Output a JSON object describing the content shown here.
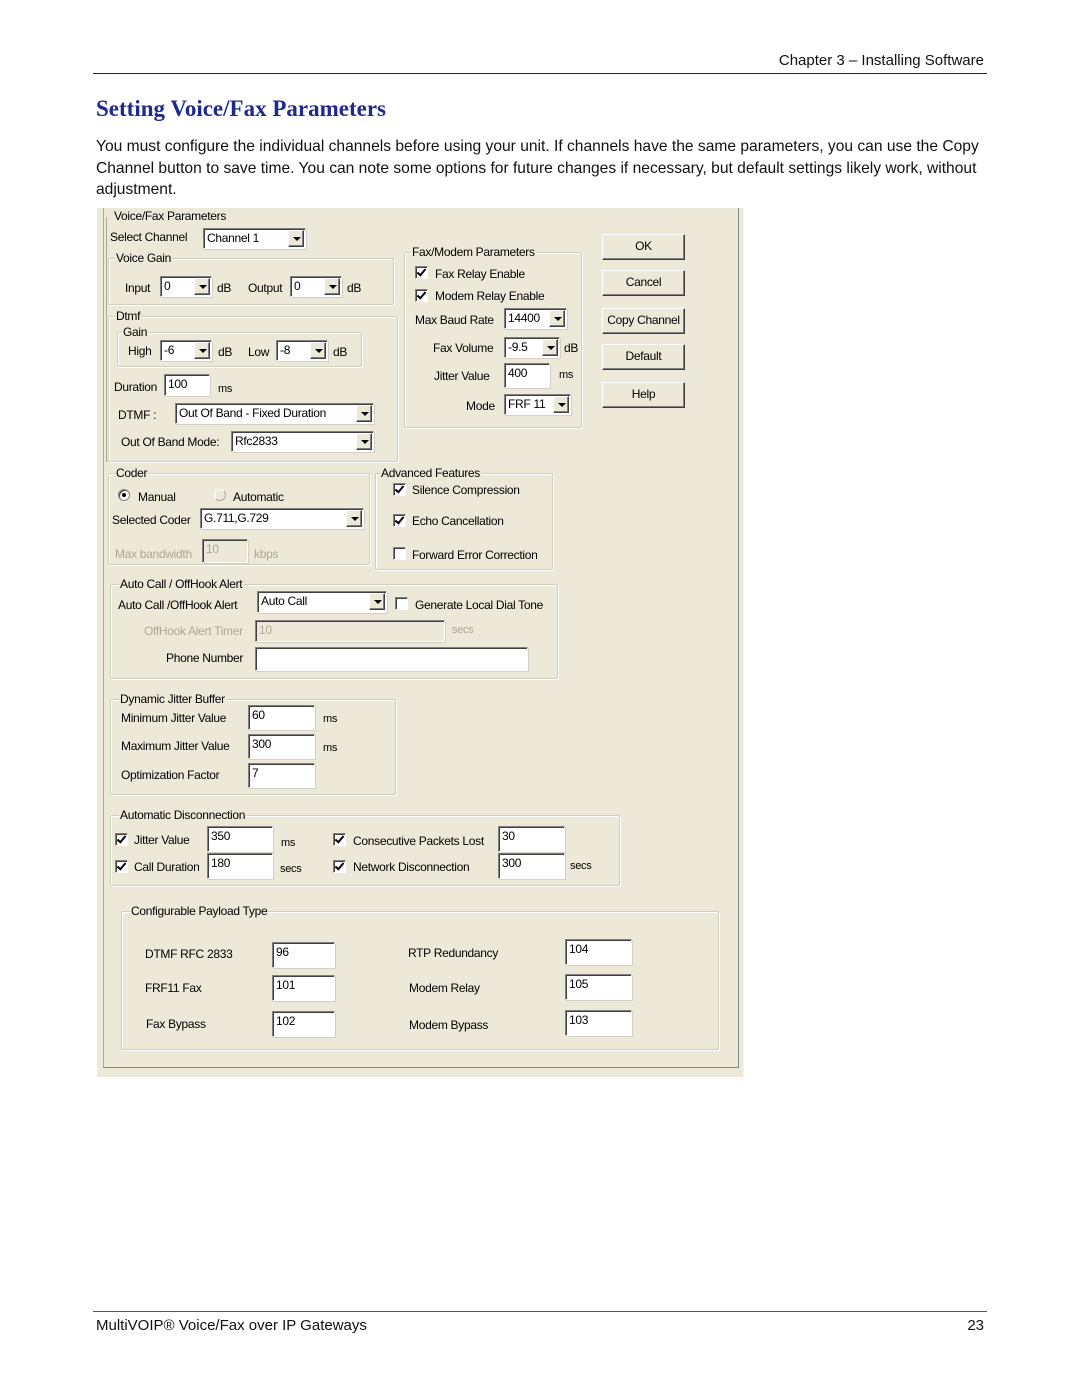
{
  "page": {
    "header": "Chapter 3 – Installing Software",
    "title": "Setting Voice/Fax Parameters",
    "paragraph": "You must configure the individual channels before using your unit. If channels have the same parameters, you can use the Copy Channel button to save time. You can note some options for future changes if necessary, but default settings likely work, without adjustment.",
    "footer_left": "MultiVOIP® Voice/Fax over IP Gateways",
    "footer_right": "23"
  },
  "dialog": {
    "group_title": "Voice/Fax Parameters",
    "select_channel": {
      "label": "Select Channel",
      "value": "Channel 1"
    },
    "voice_gain": {
      "title": "Voice Gain",
      "input_label": "Input",
      "input_value": "0",
      "output_label": "Output",
      "output_value": "0",
      "unit": "dB"
    },
    "dtmf": {
      "title": "Dtmf",
      "gain_title": "Gain",
      "high_label": "High",
      "high_value": "-6",
      "low_label": "Low",
      "low_value": "-8",
      "unit": "dB",
      "duration_label": "Duration",
      "duration_value": "100",
      "duration_unit": "ms",
      "dtmf_label": "DTMF :",
      "dtmf_value": "Out Of Band - Fixed Duration",
      "oob_label": "Out Of Band Mode:",
      "oob_value": "Rfc2833"
    },
    "fax_modem": {
      "title": "Fax/Modem Parameters",
      "fax_relay_label": "Fax Relay Enable",
      "fax_relay_checked": true,
      "modem_relay_label": "Modem Relay Enable",
      "modem_relay_checked": true,
      "baud_label": "Max Baud Rate",
      "baud_value": "14400",
      "volume_label": "Fax Volume",
      "volume_value": "-9.5",
      "volume_unit": "dB",
      "jitter_label": "Jitter Value",
      "jitter_value": "400",
      "jitter_unit": "ms",
      "mode_label": "Mode",
      "mode_value": "FRF 11"
    },
    "buttons": {
      "ok": "OK",
      "cancel": "Cancel",
      "copy": "Copy Channel",
      "default": "Default",
      "help": "Help"
    },
    "coder": {
      "title": "Coder",
      "manual_label": "Manual",
      "manual_selected": true,
      "automatic_label": "Automatic",
      "selected_label": "Selected Coder",
      "selected_value": "G.711,G.729",
      "bandwidth_label": "Max bandwidth",
      "bandwidth_value": "10",
      "bandwidth_unit": "kbps"
    },
    "advanced": {
      "title": "Advanced Features",
      "silence_label": "Silence Compression",
      "silence_checked": true,
      "echo_label": "Echo Cancellation",
      "echo_checked": true,
      "fec_label": "Forward Error Correction",
      "fec_checked": false
    },
    "autocall": {
      "title": "Auto Call / OffHook Alert",
      "mode_label": "Auto Call /OffHook Alert",
      "mode_value": "Auto Call",
      "dialtone_label": "Generate Local Dial Tone",
      "dialtone_checked": false,
      "timer_label": "OffHook Alert Timer",
      "timer_value": "10",
      "timer_unit": "secs",
      "phone_label": "Phone Number",
      "phone_value": ""
    },
    "jitter_buffer": {
      "title": "Dynamic Jitter Buffer",
      "min_label": "Minimum Jitter Value",
      "min_value": "60",
      "min_unit": "ms",
      "max_label": "Maximum Jitter Value",
      "max_value": "300",
      "max_unit": "ms",
      "opt_label": "Optimization Factor",
      "opt_value": "7"
    },
    "auto_disconnect": {
      "title": "Automatic Disconnection",
      "jitter_label": "Jitter Value",
      "jitter_value": "350",
      "jitter_unit": "ms",
      "jitter_checked": true,
      "call_label": "Call Duration",
      "call_value": "180",
      "call_unit": "secs",
      "call_checked": true,
      "packets_label": "Consecutive Packets Lost",
      "packets_value": "30",
      "packets_checked": true,
      "network_label": "Network Disconnection",
      "network_value": "300",
      "network_unit": "secs",
      "network_checked": true
    },
    "payload": {
      "title": "Configurable Payload Type",
      "dtmf_label": "DTMF RFC 2833",
      "dtmf_value": "96",
      "frf11_label": "FRF11 Fax",
      "frf11_value": "101",
      "faxbypass_label": "Fax Bypass",
      "faxbypass_value": "102",
      "rtp_label": "RTP Redundancy",
      "rtp_value": "104",
      "modemrelay_label": "Modem Relay",
      "modemrelay_value": "105",
      "modembypass_label": "Modem Bypass",
      "modembypass_value": "103"
    }
  }
}
